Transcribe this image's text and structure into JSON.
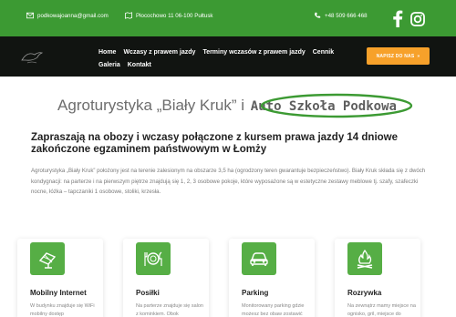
{
  "topbar": {
    "email": "podkowajoanna@gmail.com",
    "address": "Płocochowo 11 06-100 Pułtusk",
    "phone": "+48 509 666 468",
    "email_icon": "mail-icon",
    "address_icon": "map-icon",
    "phone_icon": "phone-icon",
    "social": [
      "facebook-icon",
      "instagram-icon"
    ]
  },
  "nav": {
    "logo_icon": "bird-logo-icon",
    "items": [
      "Home",
      "Wczasy z prawem jazdy",
      "Terminy wczasów z prawem jazdy",
      "Cennik",
      "Galeria",
      "Kontakt"
    ],
    "cta_label": "NAPISZ DO NAS",
    "cta_icon": "chevron-right-icon"
  },
  "hero": {
    "title_part1": "Agroturystyka „Biały Kruk” i",
    "title_part2": "Auto Szkoła Podkowa",
    "subtitle": "Zapraszają na obozy i wczasy połączone z kursem prawa jazdy 14 dniowe zakończone egzaminem państwowym w Łomży",
    "paragraph": "Agroturystyka „Biały Kruk” położony jest na terenie zalesionym na obszarze 3,5 ha (ogrodzony teren gwarantuje bezpieczeństwo). Biały Kruk składa się z dwóch kondygnacji: na parterze i na pierwszym piętrze znajdują się 1, 2, 3 osobowe pokoje, które wyposażone są w estetyczne zestawy meblowe tj. szafy, szafeczki nocne, łóżka – tapczaniki 1 osobowe, stoliki, krzesła."
  },
  "features": [
    {
      "title": "Mobilny Internet",
      "text": "W budynku znajduje się WiFi mobilny dostęp",
      "icon": "solar-panel-icon"
    },
    {
      "title": "Posiłki",
      "text": "Na parterze znajduje się salon z kominkiem. Obok",
      "icon": "dining-icon"
    },
    {
      "title": "Parking",
      "text": "Monitorowany parking gdzie możesz bez obaw zostawić",
      "icon": "car-icon"
    },
    {
      "title": "Rozrywka",
      "text": "Na zewnątrz mamy miejsce na ognisko, gril, miejsce do",
      "icon": "campfire-icon"
    }
  ],
  "colors": {
    "green": "#3c9a33",
    "dark": "#111411",
    "orange": "#f7a12a",
    "icon_bg": "#56ae45"
  }
}
